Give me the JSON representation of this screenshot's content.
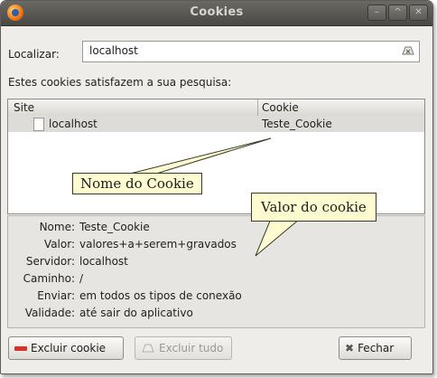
{
  "window": {
    "title": "Cookies",
    "controls": [
      "_",
      "^",
      "x"
    ]
  },
  "search": {
    "label": "Localizar:",
    "value": "localhost"
  },
  "caption": "Estes cookies satisfazem a sua pesquisa:",
  "table": {
    "headers": [
      "Site",
      "Cookie"
    ],
    "rows": [
      {
        "site": "localhost",
        "cookie": "Teste_Cookie"
      }
    ]
  },
  "details": [
    {
      "label": "Nome:",
      "value": "Teste_Cookie"
    },
    {
      "label": "Valor:",
      "value": "valores+a+serem+gravados"
    },
    {
      "label": "Servidor:",
      "value": "localhost"
    },
    {
      "label": "Caminho:",
      "value": "/"
    },
    {
      "label": "Enviar:",
      "value": "em todos os tipos de conexão"
    },
    {
      "label": "Validade:",
      "value": "até sair do aplicativo"
    }
  ],
  "buttons": {
    "delete": "Excluir cookie",
    "delete_all": "Excluir tudo",
    "close": "Fechar"
  },
  "annotations": {
    "name_callout": "Nome do Cookie",
    "value_callout": "Valor do cookie"
  }
}
